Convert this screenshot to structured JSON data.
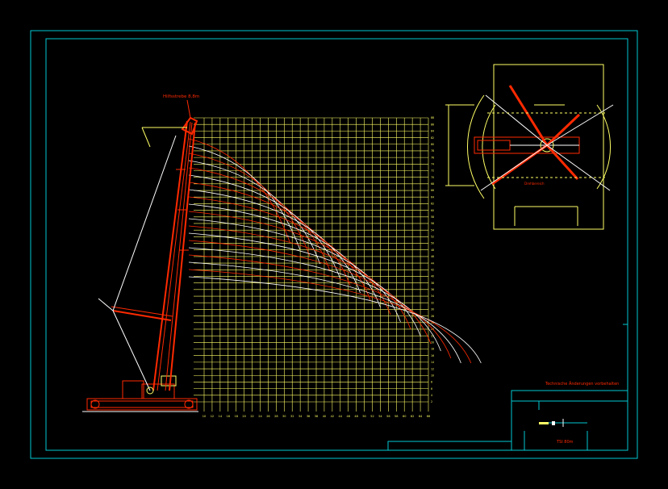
{
  "drawing": {
    "boom_label": "Hilfsstrebe 8,8m",
    "slew_label": "Drehbereich",
    "title_block_note": "Technische Änderungen vorbehalten",
    "title_block_model": "TSI 80m"
  },
  "load_chart": {
    "x_ticks": [
      10,
      12,
      14,
      16,
      18,
      20,
      22,
      24,
      26,
      28,
      30,
      32,
      34,
      36,
      38,
      40,
      42,
      44,
      46,
      48,
      50,
      52,
      54,
      56,
      58,
      60,
      62,
      64,
      66
    ],
    "y_ticks": [
      2,
      4,
      6,
      8,
      10,
      12,
      14,
      16,
      18,
      20,
      22,
      24,
      26,
      28,
      30,
      32,
      34,
      36,
      38,
      40,
      42,
      44,
      46,
      48,
      50,
      52,
      54,
      56,
      58,
      60,
      62,
      64,
      66,
      68,
      70,
      72,
      74,
      76,
      78,
      80,
      82,
      84,
      86,
      88
    ]
  },
  "colors": {
    "frame": "#00c8d2",
    "grid": "#ffff66",
    "crane": "#ff2a00",
    "curves_white": "#ffffff"
  }
}
